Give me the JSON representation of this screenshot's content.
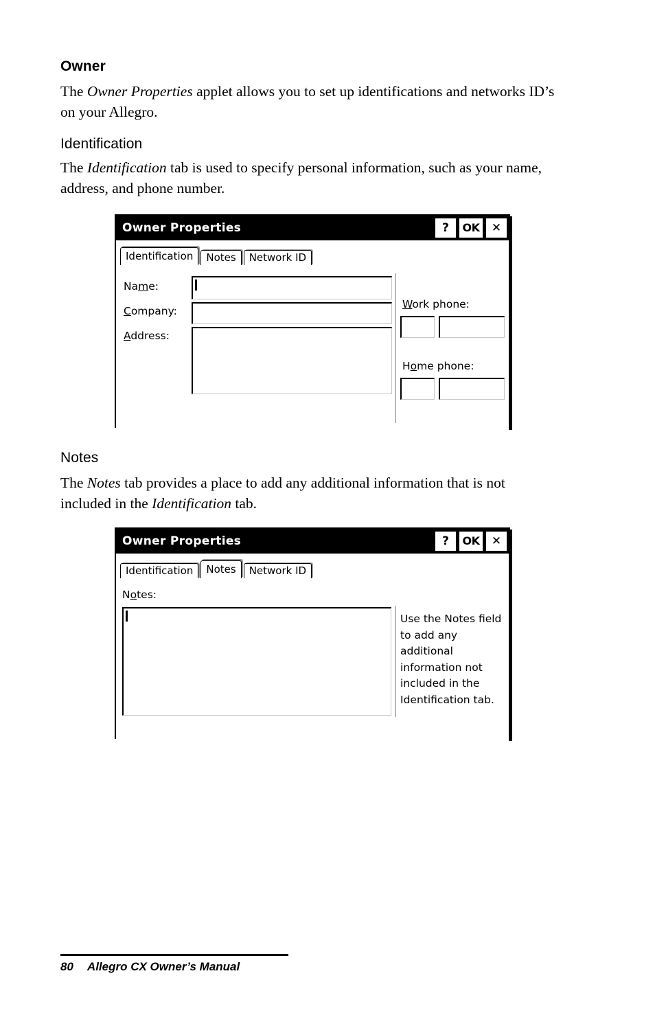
{
  "document": {
    "section_heading": "Owner",
    "intro_paragraph": {
      "part1": "The ",
      "emphasis1": "Owner Properties",
      "part2": " applet allows you to set up identifications and networks ID’s on your Allegro."
    },
    "identification_heading": "Identification",
    "identification_paragraph": {
      "part1": "The ",
      "emphasis1": "Identification",
      "part2": " tab is used to specify personal information, such as your name, address, and phone number."
    },
    "notes_heading": "Notes",
    "notes_paragraph": {
      "part1": "The ",
      "emphasis1": "Notes",
      "part2": " tab provides a place to add any additional information that is not included in the ",
      "emphasis2": "Identification",
      "part3": " tab."
    }
  },
  "footer": {
    "page_number": "80",
    "manual_title": "Allegro CX Owner’s Manual"
  },
  "dialog_identification": {
    "title": "Owner Properties",
    "titlebar_buttons": {
      "help": "?",
      "ok": "OK",
      "close": "✕"
    },
    "tabs": [
      {
        "label": "Identification",
        "active": true
      },
      {
        "label": "Notes",
        "active": false
      },
      {
        "label": "Network ID",
        "active": false
      }
    ],
    "fields": {
      "name": {
        "label_pre": "Na",
        "label_accel": "m",
        "label_post": "e:",
        "value": "",
        "focused": true
      },
      "company": {
        "label_pre": "",
        "label_accel": "C",
        "label_post": "ompany:",
        "value": ""
      },
      "address": {
        "label_pre": "",
        "label_accel": "A",
        "label_post": "ddress:",
        "value": ""
      },
      "work_phone": {
        "label_pre": "",
        "label_accel": "W",
        "label_post": "ork phone:",
        "area_code": "",
        "number": ""
      },
      "home_phone": {
        "label_pre": "H",
        "label_accel": "o",
        "label_post": "me phone:",
        "area_code": "",
        "number": ""
      }
    }
  },
  "dialog_notes": {
    "title": "Owner Properties",
    "titlebar_buttons": {
      "help": "?",
      "ok": "OK",
      "close": "✕"
    },
    "tabs": [
      {
        "label": "Identification",
        "active": false
      },
      {
        "label": "Notes",
        "active": true
      },
      {
        "label": "Network ID",
        "active": false
      }
    ],
    "notes_field": {
      "label_pre": "N",
      "label_accel": "o",
      "label_post": "tes:",
      "value": "",
      "focused": true
    },
    "help_text": "Use the Notes field to add any additional information not included in the Identification tab."
  },
  "colors": {
    "titlebar_bg": "#000000",
    "titlebar_fg": "#ffffff",
    "window_bg": "#ffffff",
    "border": "#000000",
    "field_shadow": "#c6c6c6"
  }
}
